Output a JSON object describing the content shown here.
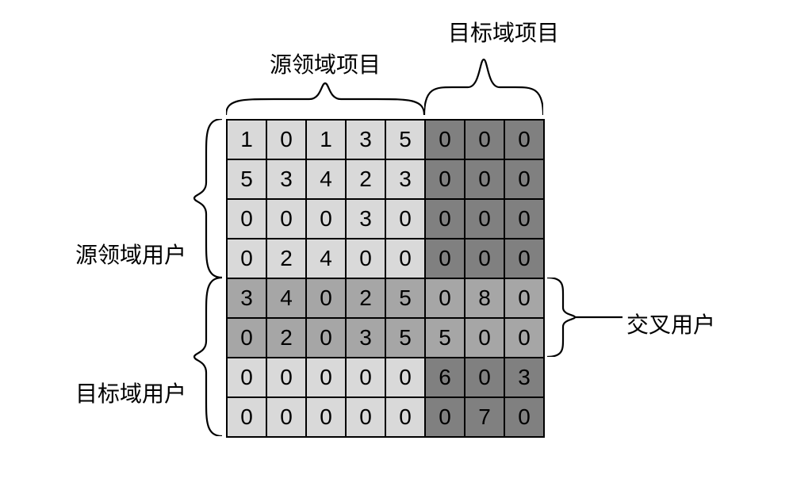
{
  "labels": {
    "source_items": "源领域项目",
    "target_items": "目标域项目",
    "source_users": "源领域用户",
    "target_users": "目标域用户",
    "cross_users": "交叉用户"
  },
  "matrix": {
    "rows": 8,
    "cols": 8,
    "source_rows": [
      0,
      1,
      2,
      3
    ],
    "target_rows": [
      4,
      5,
      6,
      7
    ],
    "cross_rows": [
      4,
      5
    ],
    "source_cols": [
      0,
      1,
      2,
      3,
      4
    ],
    "target_cols": [
      5,
      6,
      7
    ],
    "data": [
      [
        1,
        0,
        1,
        3,
        5,
        0,
        0,
        0
      ],
      [
        5,
        3,
        4,
        2,
        3,
        0,
        0,
        0
      ],
      [
        0,
        0,
        0,
        3,
        0,
        0,
        0,
        0
      ],
      [
        0,
        2,
        4,
        0,
        0,
        0,
        0,
        0
      ],
      [
        3,
        4,
        0,
        2,
        5,
        0,
        8,
        0
      ],
      [
        0,
        2,
        0,
        3,
        5,
        5,
        0,
        0
      ],
      [
        0,
        0,
        0,
        0,
        0,
        6,
        0,
        3
      ],
      [
        0,
        0,
        0,
        0,
        0,
        0,
        7,
        0
      ]
    ],
    "shading": [
      [
        "light",
        "light",
        "light",
        "light",
        "light",
        "dark",
        "dark",
        "dark"
      ],
      [
        "light",
        "light",
        "light",
        "light",
        "light",
        "dark",
        "dark",
        "dark"
      ],
      [
        "light",
        "light",
        "light",
        "light",
        "light",
        "dark",
        "dark",
        "dark"
      ],
      [
        "light",
        "light",
        "light",
        "light",
        "light",
        "dark",
        "dark",
        "dark"
      ],
      [
        "mid",
        "mid",
        "mid",
        "mid",
        "mid",
        "mid",
        "mid",
        "mid"
      ],
      [
        "mid",
        "mid",
        "mid",
        "mid",
        "mid",
        "mid",
        "mid",
        "mid"
      ],
      [
        "light",
        "light",
        "light",
        "light",
        "light",
        "dark",
        "dark",
        "dark"
      ],
      [
        "light",
        "light",
        "light",
        "light",
        "light",
        "dark",
        "dark",
        "dark"
      ]
    ]
  },
  "chart_data": {
    "type": "table",
    "description": "8x8 matrix showing user-item ratings across source and target domains",
    "row_groups": [
      {
        "name": "源领域用户",
        "rows": [
          0,
          1,
          2,
          3
        ]
      },
      {
        "name": "交叉用户",
        "rows": [
          4,
          5
        ]
      },
      {
        "name": "目标域用户",
        "rows": [
          4,
          5,
          6,
          7
        ]
      }
    ],
    "col_groups": [
      {
        "name": "源领域项目",
        "cols": [
          0,
          1,
          2,
          3,
          4
        ]
      },
      {
        "name": "目标域项目",
        "cols": [
          5,
          6,
          7
        ]
      }
    ],
    "values": [
      [
        1,
        0,
        1,
        3,
        5,
        0,
        0,
        0
      ],
      [
        5,
        3,
        4,
        2,
        3,
        0,
        0,
        0
      ],
      [
        0,
        0,
        0,
        3,
        0,
        0,
        0,
        0
      ],
      [
        0,
        2,
        4,
        0,
        0,
        0,
        0,
        0
      ],
      [
        3,
        4,
        0,
        2,
        5,
        0,
        8,
        0
      ],
      [
        0,
        2,
        0,
        3,
        5,
        5,
        0,
        0
      ],
      [
        0,
        0,
        0,
        0,
        0,
        6,
        0,
        3
      ],
      [
        0,
        0,
        0,
        0,
        0,
        0,
        7,
        0
      ]
    ]
  }
}
